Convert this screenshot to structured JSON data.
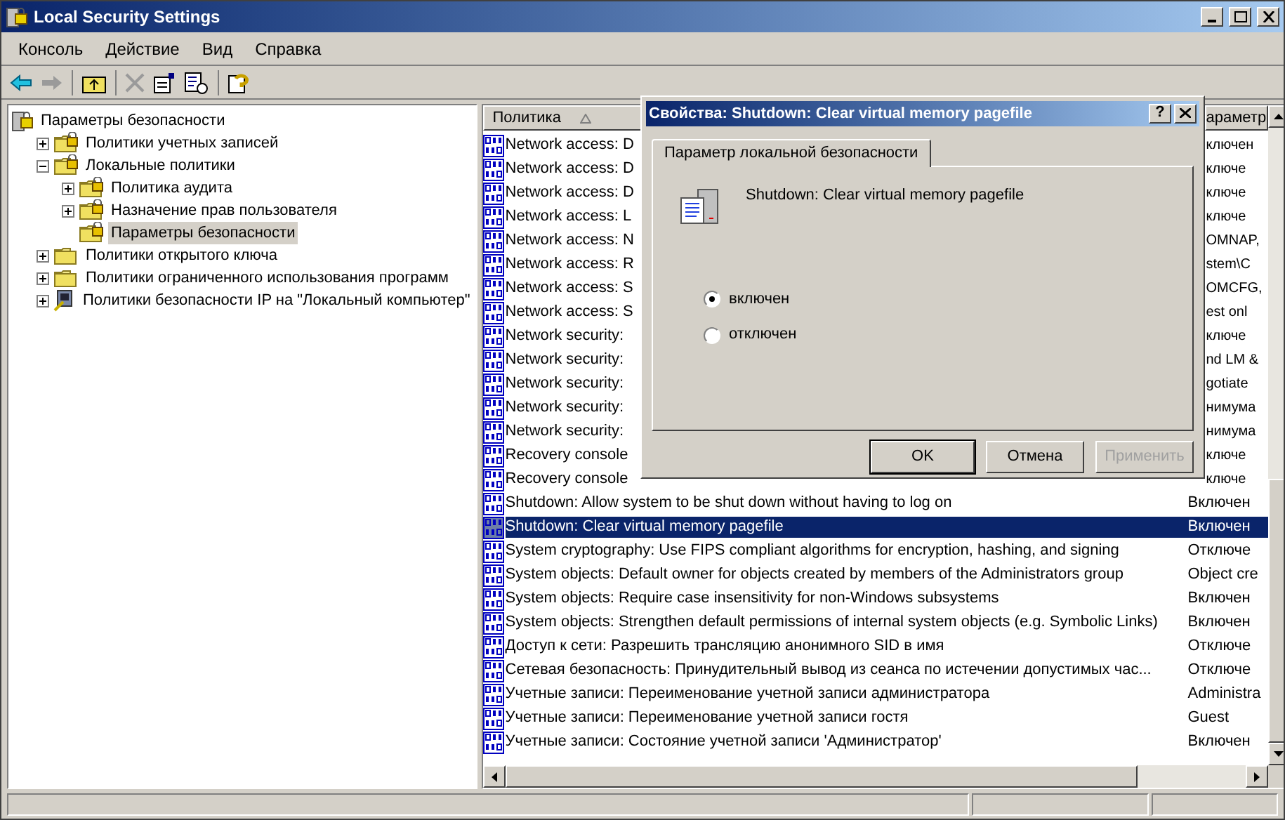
{
  "window": {
    "title": "Local Security Settings"
  },
  "menu": [
    "Консоль",
    "Действие",
    "Вид",
    "Справка"
  ],
  "tree": [
    {
      "label": "Параметры безопасности",
      "kind": "root",
      "selected": false,
      "children": [
        {
          "label": "Политики учетных записей",
          "kind": "lockfolder",
          "expanded": false,
          "selected": false
        },
        {
          "label": "Локальные политики",
          "kind": "lockfolder",
          "expanded": true,
          "selected": false,
          "children": [
            {
              "label": "Политика аудита",
              "kind": "lockfolder",
              "expanded": false,
              "selected": false
            },
            {
              "label": "Назначение прав пользователя",
              "kind": "lockfolder",
              "expanded": false,
              "selected": false
            },
            {
              "label": "Параметры безопасности",
              "kind": "lockfolder",
              "selected": true
            }
          ]
        },
        {
          "label": "Политики открытого ключа",
          "kind": "folder",
          "expanded": false,
          "selected": false
        },
        {
          "label": "Политики ограниченного использования программ",
          "kind": "folder",
          "expanded": false,
          "selected": false
        },
        {
          "label": "Политики безопасности IP на \"Локальный компьютер\"",
          "kind": "ip",
          "expanded": false,
          "selected": false
        }
      ]
    }
  ],
  "list": {
    "columns": [
      "Политика",
      "араметр"
    ],
    "rows": [
      {
        "kind": "partial",
        "policy": "Network access: D",
        "setting": "ключен",
        "selected": false
      },
      {
        "kind": "partial",
        "policy": "Network access: D",
        "setting": "ключе",
        "selected": false
      },
      {
        "kind": "partial",
        "policy": "Network access: D",
        "setting": "ключе",
        "selected": false
      },
      {
        "kind": "partial",
        "policy": "Network access: L",
        "setting": "ключе",
        "selected": false
      },
      {
        "kind": "partial",
        "policy": "Network access: N",
        "setting": "OMNAP,",
        "selected": false
      },
      {
        "kind": "partial",
        "policy": "Network access: R",
        "setting": "stem\\C",
        "selected": false
      },
      {
        "kind": "partial",
        "policy": "Network access: S",
        "setting": "OMCFG,",
        "selected": false
      },
      {
        "kind": "partial",
        "policy": "Network access: S",
        "setting": "est onl",
        "selected": false
      },
      {
        "kind": "partial",
        "policy": "Network security:",
        "setting": "ключе",
        "selected": false
      },
      {
        "kind": "partial",
        "policy": "Network security:",
        "setting": "nd LM &",
        "selected": false
      },
      {
        "kind": "partial",
        "policy": "Network security:",
        "setting": "gotiate",
        "selected": false
      },
      {
        "kind": "partial",
        "policy": "Network security:",
        "setting": "нимума",
        "selected": false
      },
      {
        "kind": "partial",
        "policy": "Network security:",
        "setting": "нимума",
        "selected": false
      },
      {
        "kind": "partial",
        "policy": "Recovery console",
        "setting": "ключе",
        "selected": false
      },
      {
        "kind": "partial",
        "policy": "Recovery console",
        "setting": "ключе",
        "selected": false
      },
      {
        "kind": "full",
        "policy": "Shutdown: Allow system to be shut down without having to log on",
        "setting": "Включен",
        "selected": false
      },
      {
        "kind": "full",
        "policy": "Shutdown: Clear virtual memory pagefile",
        "setting": "Включен",
        "selected": true
      },
      {
        "kind": "full",
        "policy": "System cryptography: Use FIPS compliant algorithms for encryption, hashing, and signing",
        "setting": "Отключе",
        "selected": false
      },
      {
        "kind": "full",
        "policy": "System objects: Default owner for objects created by members of the Administrators group",
        "setting": "Object cre",
        "selected": false
      },
      {
        "kind": "full",
        "policy": "System objects: Require case insensitivity for non-Windows subsystems",
        "setting": "Включен",
        "selected": false
      },
      {
        "kind": "full",
        "policy": "System objects: Strengthen default permissions of internal system objects (e.g. Symbolic Links)",
        "setting": "Включен",
        "selected": false
      },
      {
        "kind": "full",
        "policy": "Доступ к сети: Разрешить трансляцию анонимного SID в имя",
        "setting": "Отключе",
        "selected": false
      },
      {
        "kind": "full",
        "policy": "Сетевая безопасность: Принудительный вывод из сеанса по истечении допустимых час...",
        "setting": "Отключе",
        "selected": false
      },
      {
        "kind": "full",
        "policy": "Учетные записи: Переименование учетной записи администратора",
        "setting": "Administra",
        "selected": false
      },
      {
        "kind": "full",
        "policy": "Учетные записи: Переименование учетной записи гостя",
        "setting": "Guest",
        "selected": false
      },
      {
        "kind": "full",
        "policy": "Учетные записи: Состояние учетной записи 'Администратор'",
        "setting": "Включен",
        "selected": false
      }
    ]
  },
  "dialog": {
    "title": "Свойства: Shutdown: Clear virtual memory pagefile",
    "help": "?",
    "tabs": [
      {
        "label": "Параметр локальной безопасности",
        "selected": true
      }
    ],
    "policy_name": "Shutdown: Clear virtual memory pagefile",
    "options": [
      {
        "label": "включен",
        "selected": true
      },
      {
        "label": "отключен",
        "selected": false
      }
    ],
    "buttons": [
      {
        "label": "OK",
        "disabled": false,
        "default": true
      },
      {
        "label": "Отмена",
        "disabled": false,
        "default": false
      },
      {
        "label": "Применить",
        "disabled": true,
        "default": false
      }
    ]
  }
}
